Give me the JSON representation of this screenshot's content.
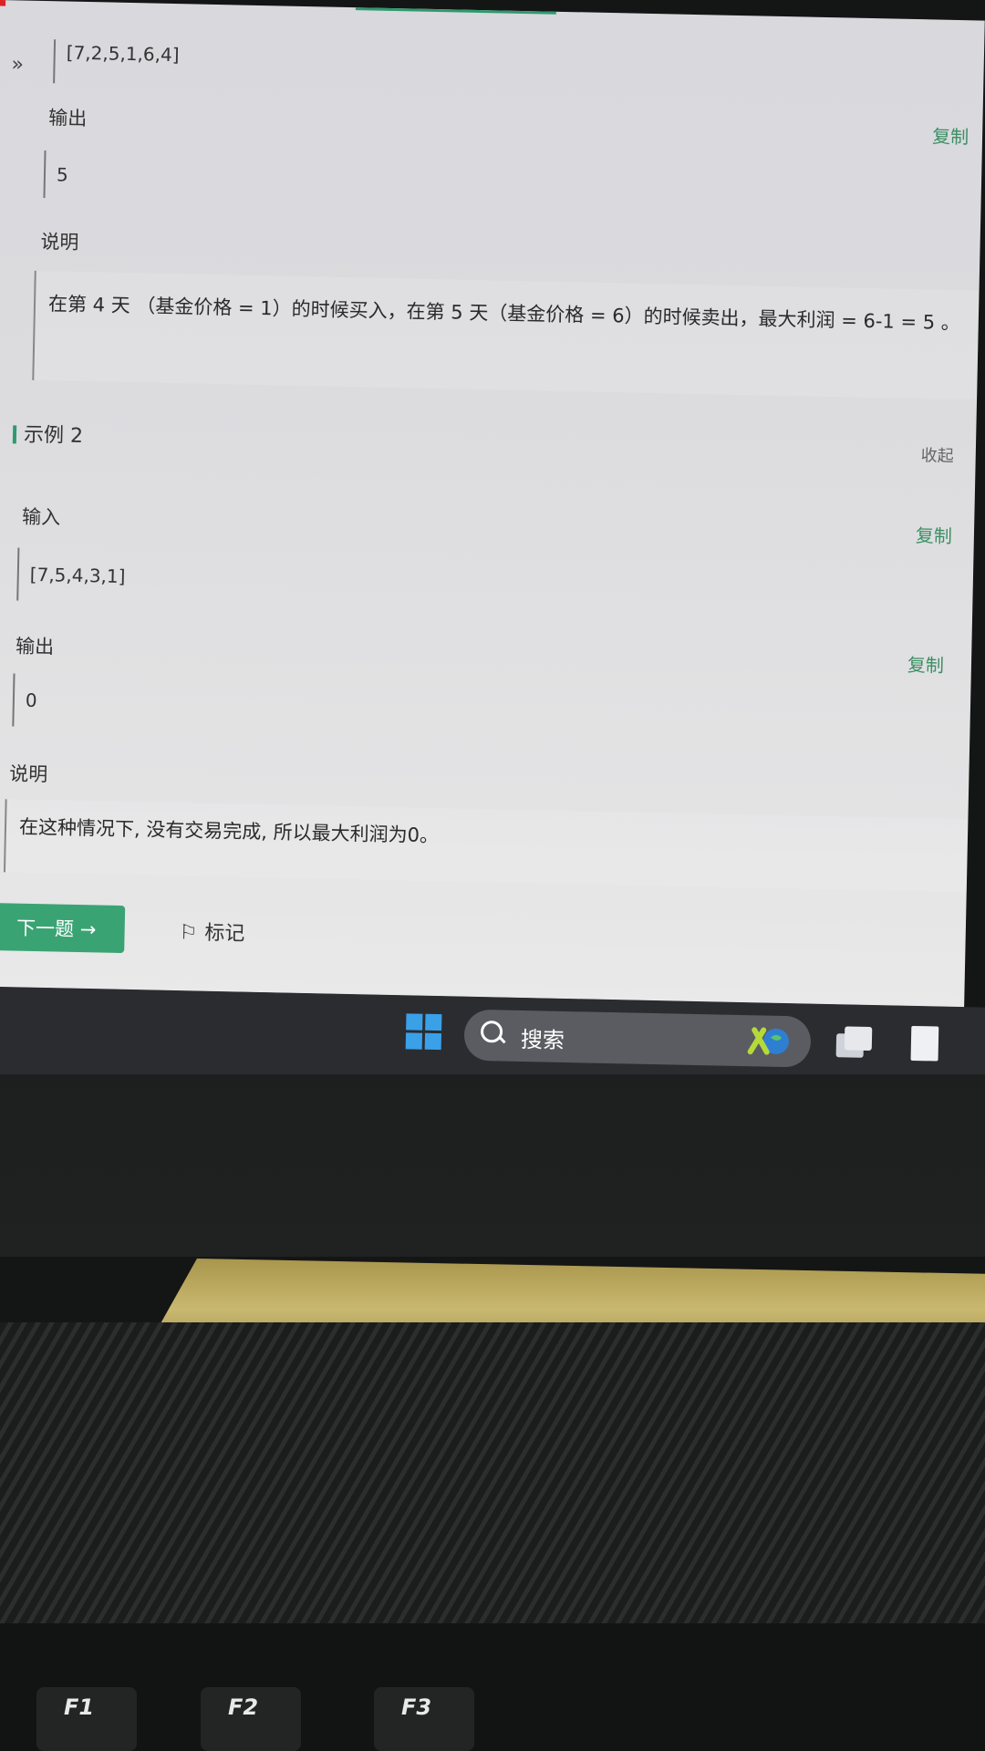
{
  "example1": {
    "input_value": "[7,2,5,1,6,4]",
    "output_label": "输出",
    "output_copy": "复制",
    "output_value": "5",
    "explain_label": "说明",
    "explain_text": "在第 4 天 （基金价格 = 1）的时候买入，在第 5 天（基金价格 = 6）的时候卖出，最大利润 = 6-1 = 5 。"
  },
  "example2": {
    "title": "示例 2",
    "collapse": "收起",
    "input_label": "输入",
    "input_copy": "复制",
    "input_value": "[7,5,4,3,1]",
    "output_label": "输出",
    "output_copy": "复制",
    "output_value": "0",
    "explain_label": "说明",
    "explain_text": "在这种情况下, 没有交易完成, 所以最大利润为0。"
  },
  "actions": {
    "next_label": "下一题 →",
    "mark_label": "标记"
  },
  "taskbar": {
    "search_label": "搜索"
  },
  "keyboard": {
    "f1": "F1",
    "f2": "F2",
    "f3": "F3"
  },
  "colors": {
    "accent": "#3aa374",
    "taskbar": "#2a2c30"
  }
}
